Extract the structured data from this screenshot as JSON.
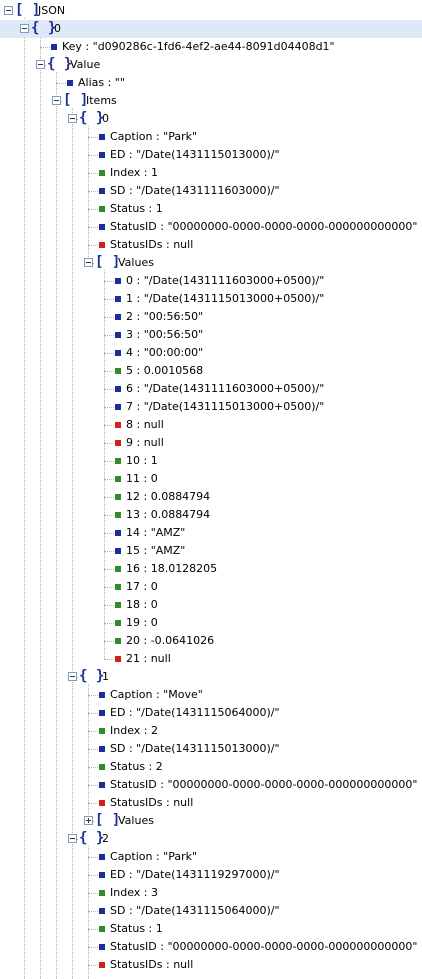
{
  "colors": {
    "string": "#1c2e9a",
    "number": "#2e8b2e",
    "null": "#cc2222",
    "selection": "#dfe8f6"
  },
  "tree": [
    {
      "type": "array",
      "level": 0,
      "text": "JSON",
      "toggle": "minus"
    },
    {
      "type": "object",
      "level": 1,
      "text": "0",
      "toggle": "minus",
      "selected": true
    },
    {
      "type": "leaf-string",
      "level": 2,
      "text": "Key : \"d090286c-1fd6-4ef2-ae44-8091d04408d1\""
    },
    {
      "type": "object",
      "level": 2,
      "text": "Value",
      "toggle": "minus"
    },
    {
      "type": "leaf-string",
      "level": 3,
      "text": "Alias : \"\""
    },
    {
      "type": "array",
      "level": 3,
      "text": "Items",
      "toggle": "minus"
    },
    {
      "type": "object",
      "level": 4,
      "text": "0",
      "toggle": "minus"
    },
    {
      "type": "leaf-string",
      "level": 5,
      "text": "Caption : \"Park\""
    },
    {
      "type": "leaf-string",
      "level": 5,
      "text": "ED : \"/Date(1431115013000)/\""
    },
    {
      "type": "leaf-number",
      "level": 5,
      "text": "Index : 1"
    },
    {
      "type": "leaf-string",
      "level": 5,
      "text": "SD : \"/Date(1431111603000)/\""
    },
    {
      "type": "leaf-number",
      "level": 5,
      "text": "Status : 1"
    },
    {
      "type": "leaf-string",
      "level": 5,
      "text": "StatusID : \"00000000-0000-0000-0000-000000000000\""
    },
    {
      "type": "leaf-null",
      "level": 5,
      "text": "StatusIDs : null"
    },
    {
      "type": "array",
      "level": 5,
      "text": "Values",
      "toggle": "minus"
    },
    {
      "type": "leaf-string",
      "level": 6,
      "text": "0 : \"/Date(1431111603000+0500)/\""
    },
    {
      "type": "leaf-string",
      "level": 6,
      "text": "1 : \"/Date(1431115013000+0500)/\""
    },
    {
      "type": "leaf-string",
      "level": 6,
      "text": "2 : \"00:56:50\""
    },
    {
      "type": "leaf-string",
      "level": 6,
      "text": "3 : \"00:56:50\""
    },
    {
      "type": "leaf-string",
      "level": 6,
      "text": "4 : \"00:00:00\""
    },
    {
      "type": "leaf-number",
      "level": 6,
      "text": "5 : 0.0010568"
    },
    {
      "type": "leaf-string",
      "level": 6,
      "text": "6 : \"/Date(1431111603000+0500)/\""
    },
    {
      "type": "leaf-string",
      "level": 6,
      "text": "7 : \"/Date(1431115013000+0500)/\""
    },
    {
      "type": "leaf-null",
      "level": 6,
      "text": "8 : null"
    },
    {
      "type": "leaf-null",
      "level": 6,
      "text": "9 : null"
    },
    {
      "type": "leaf-number",
      "level": 6,
      "text": "10 : 1"
    },
    {
      "type": "leaf-number",
      "level": 6,
      "text": "11 : 0"
    },
    {
      "type": "leaf-number",
      "level": 6,
      "text": "12 : 0.0884794"
    },
    {
      "type": "leaf-number",
      "level": 6,
      "text": "13 : 0.0884794"
    },
    {
      "type": "leaf-string",
      "level": 6,
      "text": "14 : \"AMZ\""
    },
    {
      "type": "leaf-string",
      "level": 6,
      "text": "15 : \"AMZ\""
    },
    {
      "type": "leaf-number",
      "level": 6,
      "text": "16 : 18.0128205"
    },
    {
      "type": "leaf-number",
      "level": 6,
      "text": "17 : 0"
    },
    {
      "type": "leaf-number",
      "level": 6,
      "text": "18 : 0"
    },
    {
      "type": "leaf-number",
      "level": 6,
      "text": "19 : 0"
    },
    {
      "type": "leaf-number",
      "level": 6,
      "text": "20 : -0.0641026"
    },
    {
      "type": "leaf-null",
      "level": 6,
      "text": "21 : null"
    },
    {
      "type": "object",
      "level": 4,
      "text": "1",
      "toggle": "minus"
    },
    {
      "type": "leaf-string",
      "level": 5,
      "text": "Caption : \"Move\""
    },
    {
      "type": "leaf-string",
      "level": 5,
      "text": "ED : \"/Date(1431115064000)/\""
    },
    {
      "type": "leaf-number",
      "level": 5,
      "text": "Index : 2"
    },
    {
      "type": "leaf-string",
      "level": 5,
      "text": "SD : \"/Date(1431115013000)/\""
    },
    {
      "type": "leaf-number",
      "level": 5,
      "text": "Status : 2"
    },
    {
      "type": "leaf-string",
      "level": 5,
      "text": "StatusID : \"00000000-0000-0000-0000-000000000000\""
    },
    {
      "type": "leaf-null",
      "level": 5,
      "text": "StatusIDs : null"
    },
    {
      "type": "array",
      "level": 5,
      "text": "Values",
      "toggle": "plus"
    },
    {
      "type": "object",
      "level": 4,
      "text": "2",
      "toggle": "minus"
    },
    {
      "type": "leaf-string",
      "level": 5,
      "text": "Caption : \"Park\""
    },
    {
      "type": "leaf-string",
      "level": 5,
      "text": "ED : \"/Date(1431119297000)/\""
    },
    {
      "type": "leaf-number",
      "level": 5,
      "text": "Index : 3"
    },
    {
      "type": "leaf-string",
      "level": 5,
      "text": "SD : \"/Date(1431115064000)/\""
    },
    {
      "type": "leaf-number",
      "level": 5,
      "text": "Status : 1"
    },
    {
      "type": "leaf-string",
      "level": 5,
      "text": "StatusID : \"00000000-0000-0000-0000-000000000000\""
    },
    {
      "type": "leaf-null",
      "level": 5,
      "text": "StatusIDs : null"
    }
  ]
}
